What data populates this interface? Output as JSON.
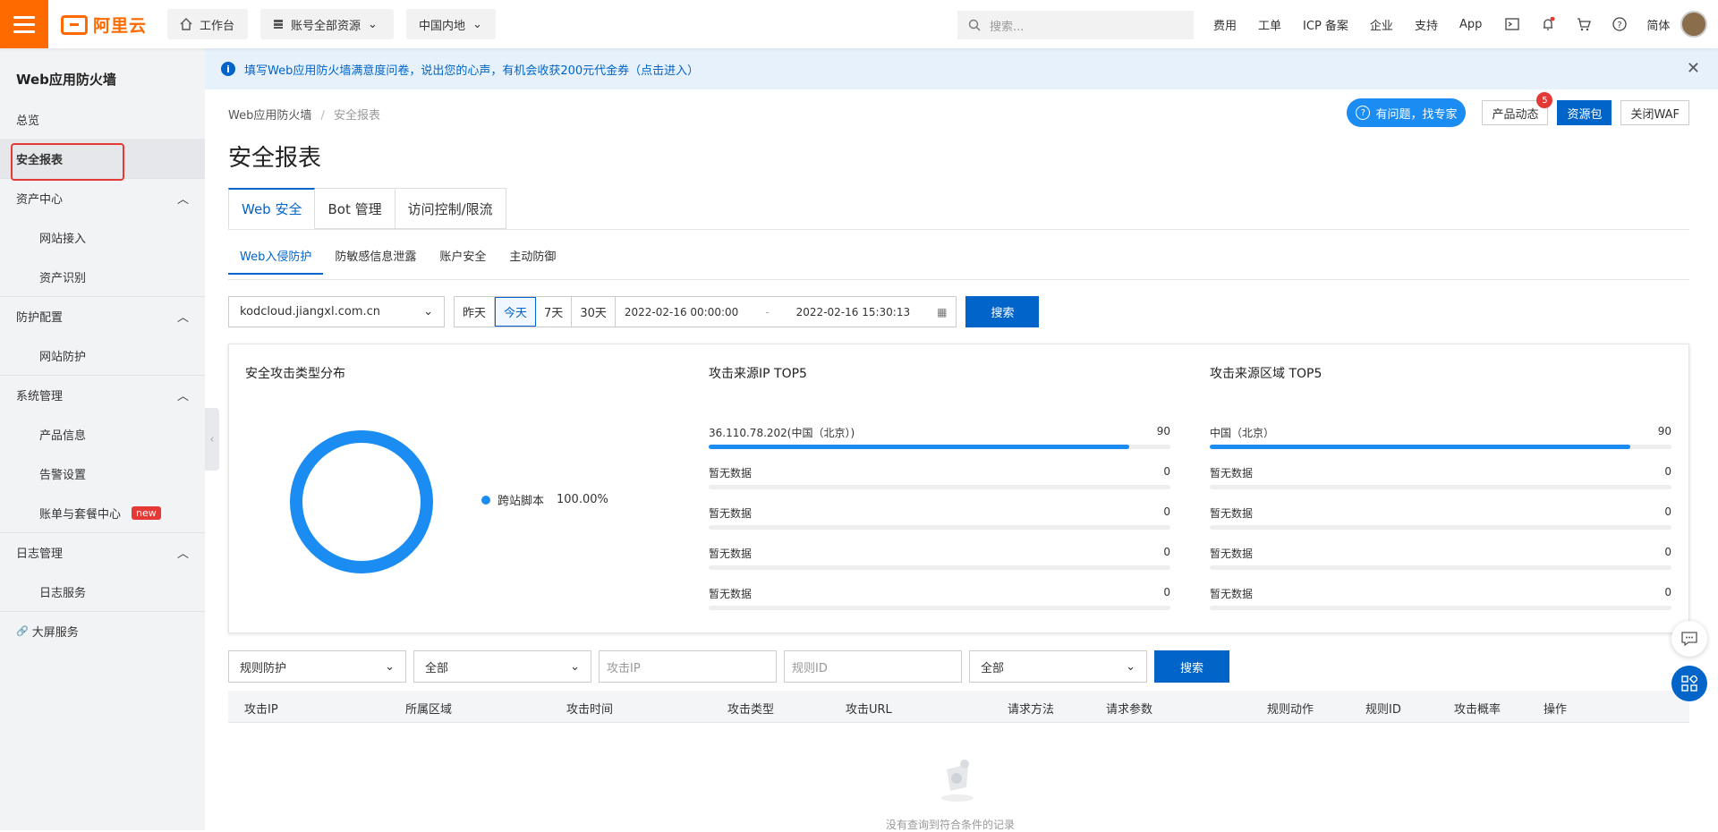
{
  "topbar": {
    "logo_text": "阿里云",
    "workbench": "工作台",
    "account_resources": "账号全部资源",
    "region": "中国内地",
    "search_placeholder": "搜索...",
    "links": [
      "费用",
      "工单",
      "ICP 备案",
      "企业",
      "支持",
      "App"
    ],
    "lang": "简体"
  },
  "sidebar": {
    "title": "Web应用防火墙",
    "overview": "总览",
    "security_report": "安全报表",
    "asset_center": "资产中心",
    "site_access": "网站接入",
    "asset_identify": "资产识别",
    "protection_config": "防护配置",
    "site_protection": "网站防护",
    "system_mgmt": "系统管理",
    "product_info": "产品信息",
    "alert_settings": "告警设置",
    "billing_center": "账单与套餐中心",
    "new_badge": "new",
    "log_mgmt": "日志管理",
    "log_service": "日志服务",
    "big_screen": "大屏服务"
  },
  "notice": {
    "text": "填写Web应用防火墙满意度问卷，说出您的心声，有机会收获200元代金券（点击进入）"
  },
  "breadcrumb": {
    "root": "Web应用防火墙",
    "current": "安全报表"
  },
  "page_title": "安全报表",
  "actions": {
    "expert": "有问题，找专家",
    "news": "产品动态",
    "news_count": "5",
    "package": "资源包",
    "close_waf": "关闭WAF"
  },
  "tabs": [
    "Web 安全",
    "Bot 管理",
    "访问控制/限流"
  ],
  "subtabs": [
    "Web入侵防护",
    "防敏感信息泄露",
    "账户安全",
    "主动防御"
  ],
  "filters": {
    "domain": "kodcloud.jiangxl.com.cn",
    "ranges": [
      "昨天",
      "今天",
      "7天",
      "30天"
    ],
    "start": "2022-02-16 00:00:00",
    "end": "2022-02-16 15:30:13",
    "search": "搜索"
  },
  "attack_type": {
    "title": "安全攻击类型分布",
    "legend_name": "跨站脚本",
    "legend_pct": "100.00%"
  },
  "top_ip": {
    "title": "攻击来源IP TOP5",
    "rows": [
      {
        "label": "36.110.78.202(中国（北京）)",
        "value": "90",
        "fill": 0.91
      },
      {
        "label": "暂无数据",
        "value": "0",
        "fill": 0
      },
      {
        "label": "暂无数据",
        "value": "0",
        "fill": 0
      },
      {
        "label": "暂无数据",
        "value": "0",
        "fill": 0
      },
      {
        "label": "暂无数据",
        "value": "0",
        "fill": 0
      }
    ]
  },
  "top_region": {
    "title": "攻击来源区域 TOP5",
    "rows": [
      {
        "label": "中国（北京）",
        "value": "90",
        "fill": 0.91
      },
      {
        "label": "暂无数据",
        "value": "0",
        "fill": 0
      },
      {
        "label": "暂无数据",
        "value": "0",
        "fill": 0
      },
      {
        "label": "暂无数据",
        "value": "0",
        "fill": 0
      },
      {
        "label": "暂无数据",
        "value": "0",
        "fill": 0
      }
    ]
  },
  "log_filters": {
    "rule_protection": "规则防护",
    "all1": "全部",
    "ip_placeholder": "攻击IP",
    "rule_placeholder": "规则ID",
    "all2": "全部",
    "search": "搜索"
  },
  "table": {
    "headers": [
      "攻击IP",
      "所属区域",
      "攻击时间",
      "攻击类型",
      "攻击URL",
      "请求方法",
      "请求参数",
      "规则动作",
      "规则ID",
      "攻击概率",
      "操作"
    ],
    "empty": "没有查询到符合条件的记录"
  }
}
